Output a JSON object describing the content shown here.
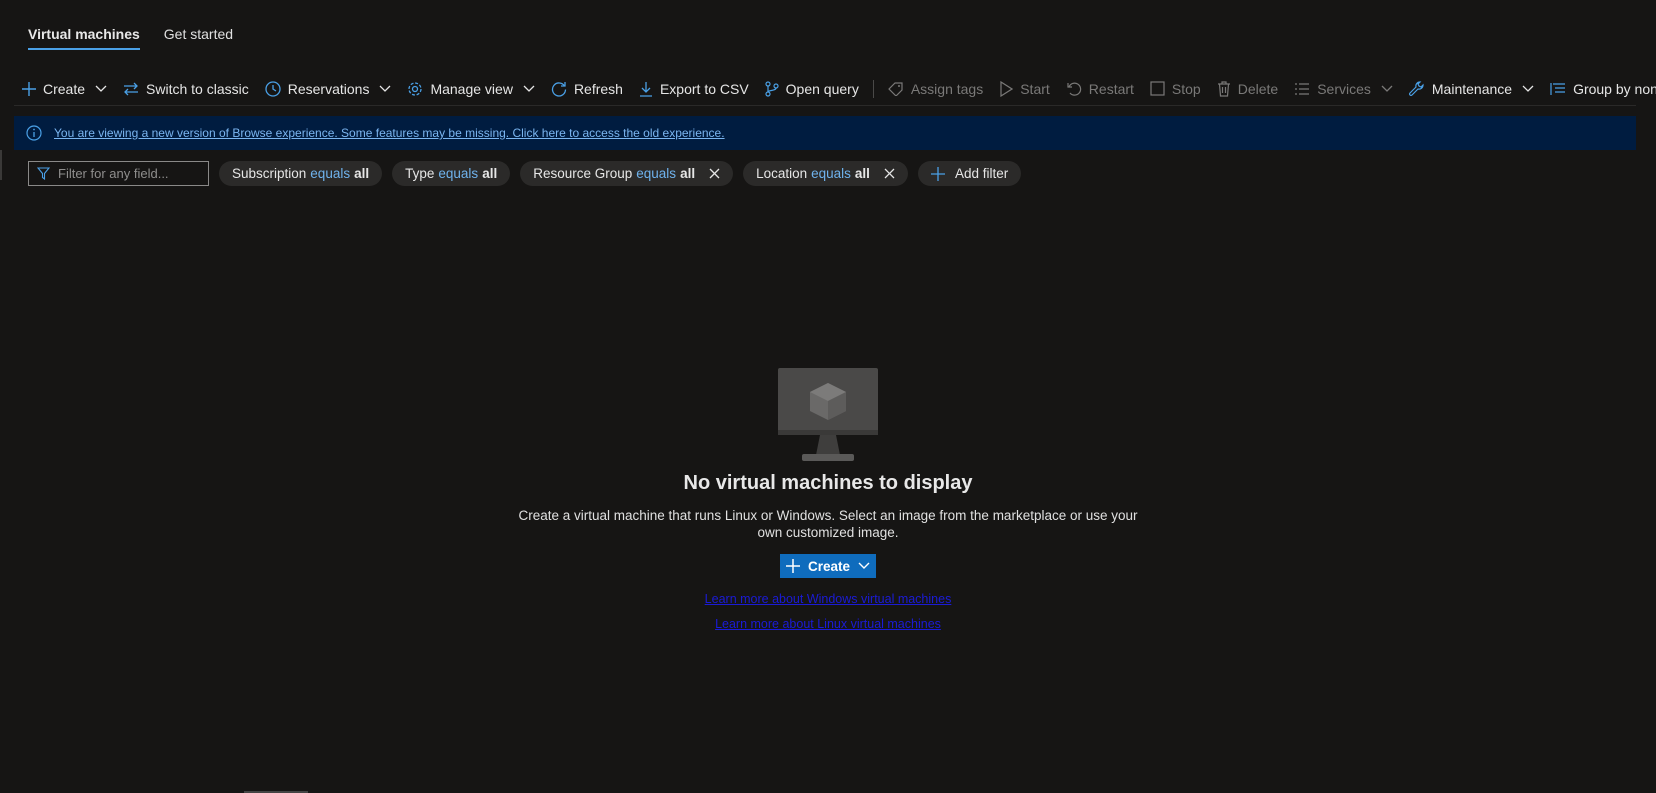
{
  "tabs": [
    {
      "label": "Virtual machines",
      "active": true
    },
    {
      "label": "Get started",
      "active": false
    }
  ],
  "toolbar": {
    "create": "Create",
    "switch_classic": "Switch to classic",
    "reservations": "Reservations",
    "manage_view": "Manage view",
    "refresh": "Refresh",
    "export_csv": "Export to CSV",
    "open_query": "Open query",
    "assign_tags": "Assign tags",
    "start": "Start",
    "restart": "Restart",
    "stop": "Stop",
    "delete": "Delete",
    "services": "Services",
    "maintenance": "Maintenance",
    "group_by": "Group by none"
  },
  "banner": {
    "text": "You are viewing a new version of Browse experience. Some features may be missing. Click here to access the old experience."
  },
  "filters": {
    "placeholder": "Filter for any field...",
    "pills": [
      {
        "field": "Subscription",
        "op": "equals",
        "value": "all"
      },
      {
        "field": "Type",
        "op": "equals",
        "value": "all"
      },
      {
        "field": "Resource Group",
        "op": "equals",
        "value": "all"
      },
      {
        "field": "Location",
        "op": "equals",
        "value": "all"
      }
    ],
    "add_filter": "Add filter"
  },
  "empty_state": {
    "title": "No virtual machines to display",
    "description": "Create a virtual machine that runs Linux or Windows. Select an image from the marketplace or use your own customized image.",
    "create_label": "Create",
    "learn_windows": "Learn more about Windows virtual machines",
    "learn_linux": "Learn more about Linux virtual machines"
  },
  "colors": {
    "accent": "#4aa0e6",
    "banner_bg": "#001c40",
    "primary_button": "#0f6cbd",
    "link": "#1b1bd6"
  }
}
